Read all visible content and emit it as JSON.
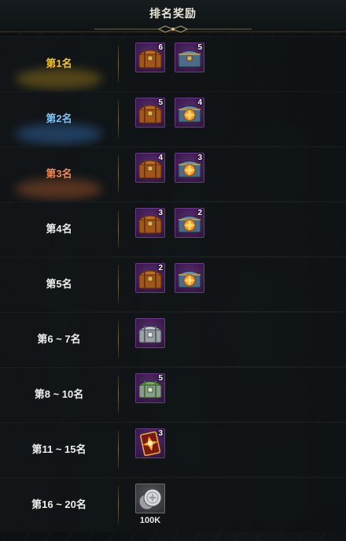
{
  "header": {
    "title": "排名奖励"
  },
  "colors": {
    "gold": "#f2c230",
    "silver_blue": "#7fc3f5",
    "bronze": "#ef8a55",
    "white": "#f0f0ee"
  },
  "rows": [
    {
      "rank": "第1名",
      "color": "#f2c230",
      "rewards": [
        {
          "icon": "wooden-chest-icon",
          "qty": "6"
        },
        {
          "icon": "steel-chest-icon",
          "qty": "5"
        }
      ]
    },
    {
      "rank": "第2名",
      "color": "#7fc3f5",
      "rewards": [
        {
          "icon": "wooden-chest-icon",
          "qty": "5"
        },
        {
          "icon": "ornate-steel-chest-icon",
          "qty": "4"
        }
      ]
    },
    {
      "rank": "第3名",
      "color": "#ef8a55",
      "rewards": [
        {
          "icon": "wooden-chest-icon",
          "qty": "4"
        },
        {
          "icon": "ornate-steel-chest-icon",
          "qty": "3"
        }
      ]
    },
    {
      "rank": "第4名",
      "color": "#f0f0ee",
      "rewards": [
        {
          "icon": "wooden-chest-icon",
          "qty": "3"
        },
        {
          "icon": "ornate-steel-chest-icon",
          "qty": "2"
        }
      ]
    },
    {
      "rank": "第5名",
      "color": "#f0f0ee",
      "rewards": [
        {
          "icon": "wooden-chest-icon",
          "qty": "2"
        },
        {
          "icon": "ornate-steel-chest-icon",
          "qty": ""
        }
      ]
    },
    {
      "rank": "第6 ~ 7名",
      "color": "#f0f0ee",
      "rewards": [
        {
          "icon": "silver-chest-icon",
          "qty": ""
        }
      ]
    },
    {
      "rank": "第8 ~ 10名",
      "color": "#f0f0ee",
      "rewards": [
        {
          "icon": "green-chest-icon",
          "qty": "5"
        }
      ]
    },
    {
      "rank": "第11 ~ 15名",
      "color": "#f0f0ee",
      "rewards": [
        {
          "icon": "skill-card-icon",
          "qty": "3"
        }
      ]
    },
    {
      "rank": "第16 ~ 20名",
      "color": "#f0f0ee",
      "rewards": [
        {
          "icon": "silver-coins-icon",
          "qty": "",
          "caption": "100K"
        }
      ]
    }
  ]
}
